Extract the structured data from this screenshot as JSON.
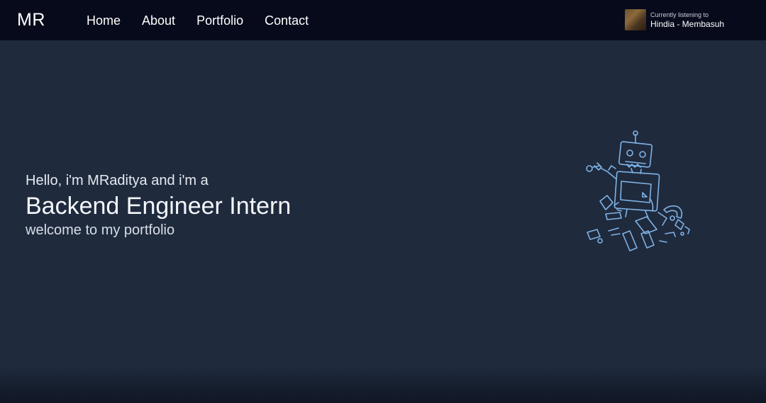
{
  "brand": "MR",
  "nav": {
    "items": [
      {
        "label": "Home"
      },
      {
        "label": "About"
      },
      {
        "label": "Portfolio"
      },
      {
        "label": "Contact"
      }
    ]
  },
  "now_playing": {
    "caption": "Currently listening to",
    "track": "Hindia - Membasuh"
  },
  "hero": {
    "greeting": "Hello, i'm MRaditya and i'm a",
    "role": "Backend Engineer Intern",
    "welcome": "welcome to my portfolio"
  },
  "colors": {
    "background": "#1f2a3d",
    "navbar": "#060a1a",
    "illustration": "#7fb3e6"
  },
  "icons": {
    "illustration": "broken-robot-illustration",
    "album": "album-art-thumbnail"
  }
}
